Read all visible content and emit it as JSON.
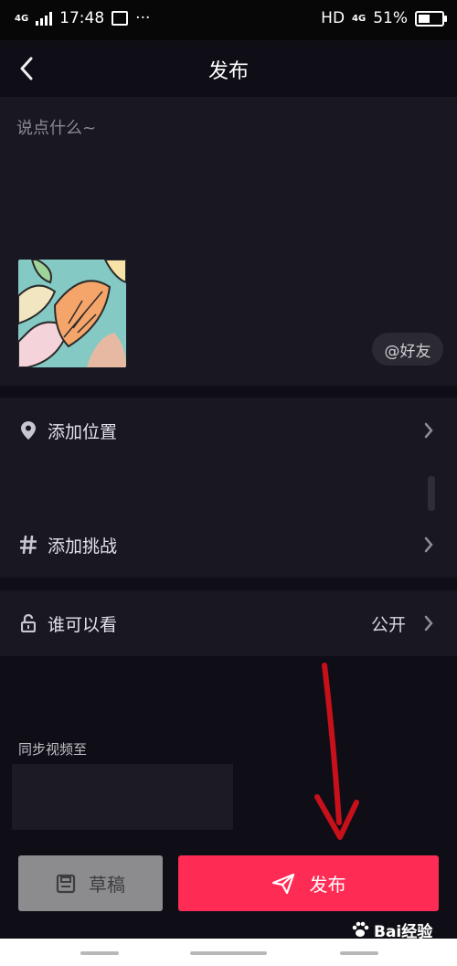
{
  "status_bar": {
    "network_left": "4G",
    "time": "17:48",
    "dots": "···",
    "hd": "HD",
    "network_right": "4G",
    "battery": "51%",
    "battery_level": 0.51
  },
  "header": {
    "back_icon": "chevron-left-icon",
    "title": "发布"
  },
  "compose": {
    "placeholder": "说点什么~",
    "mention_label": "@好友"
  },
  "options": [
    {
      "icon": "location-pin-icon",
      "label": "添加位置"
    },
    {
      "icon": "hashtag-icon",
      "label": "添加挑战"
    }
  ],
  "visibility": {
    "icon": "unlock-icon",
    "label": "谁可以看",
    "value": "公开"
  },
  "sync": {
    "label": "同步视频至"
  },
  "actions": {
    "draft_label": "草稿",
    "publish_label": "发布"
  },
  "watermark": {
    "text": "Bai经验"
  },
  "colors": {
    "background": "#0f0e17",
    "panel": "#181722",
    "publish": "#fe2c55",
    "draft": "#8c8c8f",
    "annotation_arrow": "#c8101a"
  }
}
